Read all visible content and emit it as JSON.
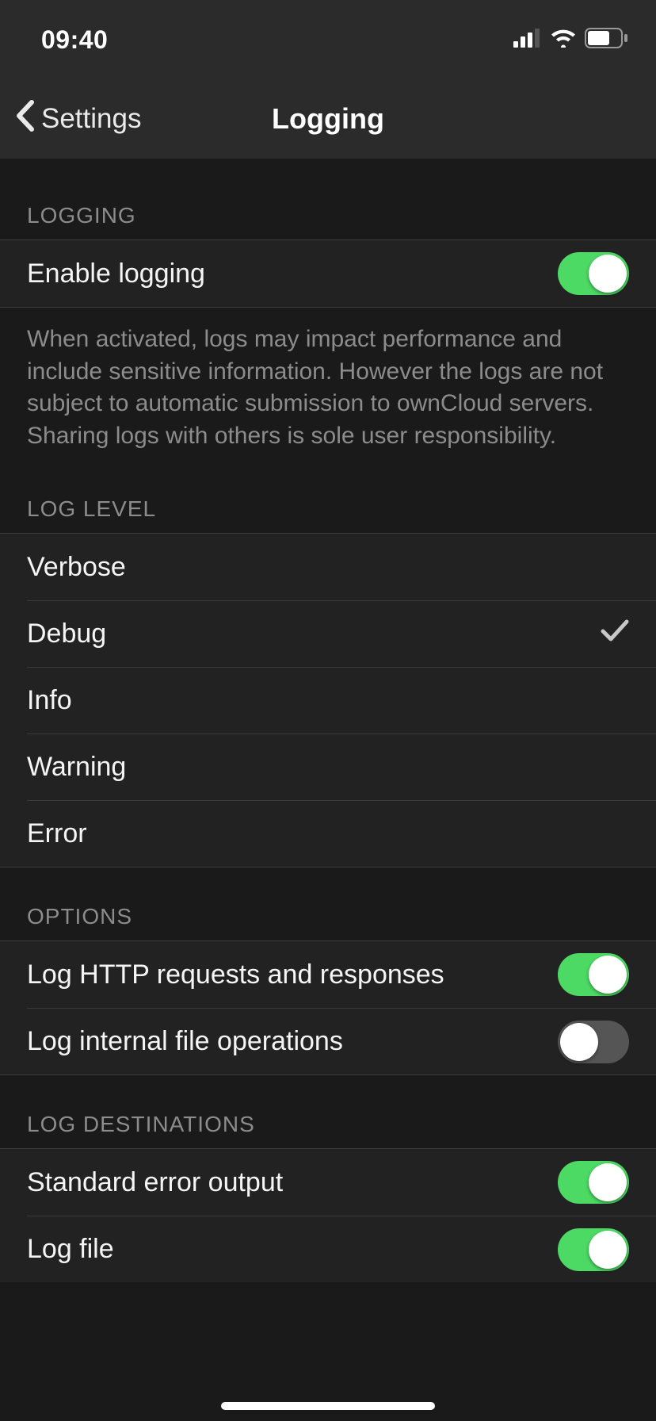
{
  "status_bar": {
    "time": "09:40"
  },
  "nav": {
    "back_label": "Settings",
    "title": "Logging"
  },
  "sections": {
    "logging": {
      "header": "LOGGING",
      "enable_label": "Enable logging",
      "enable_on": true,
      "footer": "When activated, logs may impact performance and include sensitive information. However the logs are not subject to automatic submission to ownCloud servers. Sharing logs with others is sole user responsibility."
    },
    "log_level": {
      "header": "LOG LEVEL",
      "options": [
        {
          "label": "Verbose",
          "selected": false
        },
        {
          "label": "Debug",
          "selected": true
        },
        {
          "label": "Info",
          "selected": false
        },
        {
          "label": "Warning",
          "selected": false
        },
        {
          "label": "Error",
          "selected": false
        }
      ]
    },
    "options": {
      "header": "OPTIONS",
      "http_label": "Log HTTP requests and responses",
      "http_on": true,
      "fileops_label": "Log internal file operations",
      "fileops_on": false
    },
    "destinations": {
      "header": "LOG DESTINATIONS",
      "stderr_label": "Standard error output",
      "stderr_on": true,
      "file_label": "Log file",
      "file_on": true
    }
  }
}
